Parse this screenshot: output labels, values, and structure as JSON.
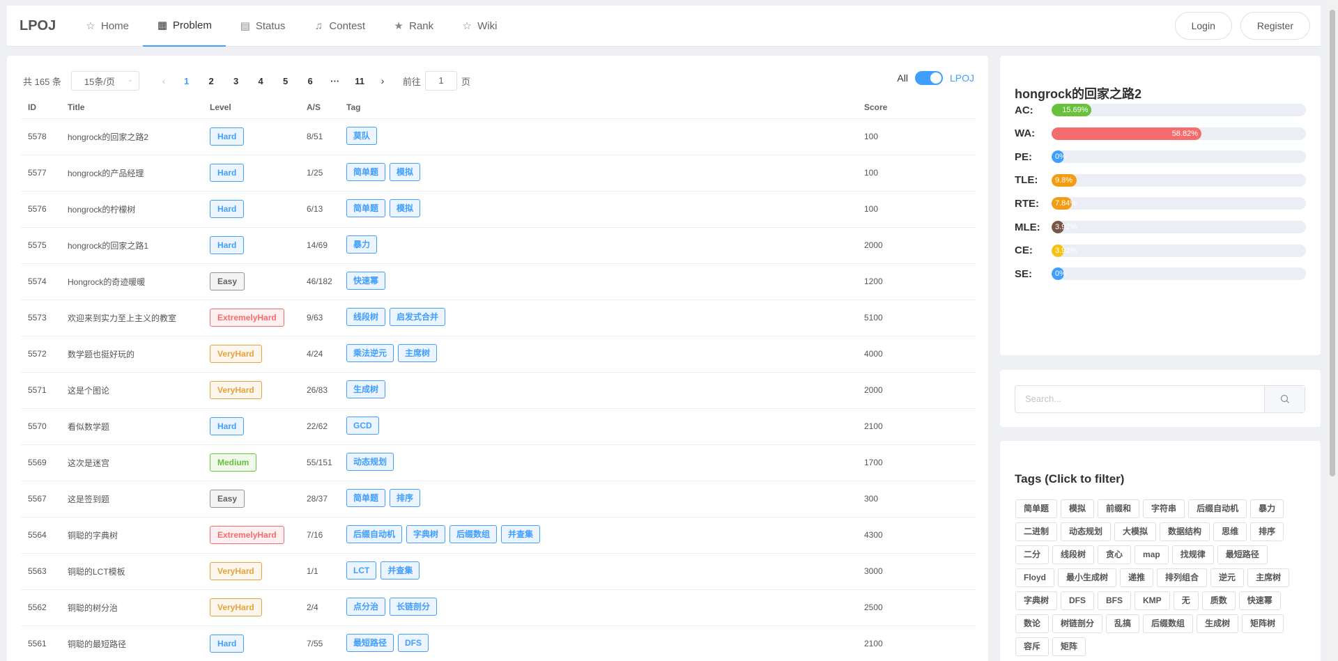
{
  "nav": {
    "logo": "LPOJ",
    "items": [
      {
        "label": "Home",
        "icon": "☆"
      },
      {
        "label": "Problem",
        "icon": "▦"
      },
      {
        "label": "Status",
        "icon": "▤"
      },
      {
        "label": "Contest",
        "icon": "♫"
      },
      {
        "label": "Rank",
        "icon": "★"
      },
      {
        "label": "Wiki",
        "icon": "☆"
      }
    ],
    "login": "Login",
    "register": "Register"
  },
  "pager": {
    "total": "共 165 条",
    "page_size": "15条/页",
    "pages": [
      "1",
      "2",
      "3",
      "4",
      "5",
      "6",
      "···",
      "11"
    ],
    "goto_prefix": "前往",
    "goto_value": "1",
    "goto_suffix": "页"
  },
  "toggle": {
    "left": "All",
    "right": "LPOJ"
  },
  "table": {
    "headers": {
      "id": "ID",
      "title": "Title",
      "level": "Level",
      "as": "A/S",
      "tag": "Tag",
      "score": "Score"
    },
    "rows": [
      {
        "id": "5578",
        "title": "hongrock的回家之路2",
        "level": "Hard",
        "as": "8/51",
        "tags": [
          "莫队"
        ],
        "score": "100"
      },
      {
        "id": "5577",
        "title": "hongrock的产品经理",
        "level": "Hard",
        "as": "1/25",
        "tags": [
          "简单题",
          "模拟"
        ],
        "score": "100"
      },
      {
        "id": "5576",
        "title": "hongrock的柠檬树",
        "level": "Hard",
        "as": "6/13",
        "tags": [
          "简单题",
          "模拟"
        ],
        "score": "100"
      },
      {
        "id": "5575",
        "title": "hongrock的回家之路1",
        "level": "Hard",
        "as": "14/69",
        "tags": [
          "暴力"
        ],
        "score": "2000"
      },
      {
        "id": "5574",
        "title": "Hongrock的奇迹暖暖",
        "level": "Easy",
        "as": "46/182",
        "tags": [
          "快速幂"
        ],
        "score": "1200"
      },
      {
        "id": "5573",
        "title": "欢迎来到实力至上主义的教室",
        "level": "ExtremelyHard",
        "as": "9/63",
        "tags": [
          "线段树",
          "启发式合并"
        ],
        "score": "5100"
      },
      {
        "id": "5572",
        "title": "数学题也挺好玩的",
        "level": "VeryHard",
        "as": "4/24",
        "tags": [
          "乘法逆元",
          "主席树"
        ],
        "score": "4000"
      },
      {
        "id": "5571",
        "title": "这是个图论",
        "level": "VeryHard",
        "as": "26/83",
        "tags": [
          "生成树"
        ],
        "score": "2000"
      },
      {
        "id": "5570",
        "title": "看似数学题",
        "level": "Hard",
        "as": "22/62",
        "tags": [
          "GCD"
        ],
        "score": "2100"
      },
      {
        "id": "5569",
        "title": "这次是迷宫",
        "level": "Medium",
        "as": "55/151",
        "tags": [
          "动态规划"
        ],
        "score": "1700"
      },
      {
        "id": "5567",
        "title": "这是签到题",
        "level": "Easy",
        "as": "28/37",
        "tags": [
          "简单题",
          "排序"
        ],
        "score": "300"
      },
      {
        "id": "5564",
        "title": "铜聪的字典树",
        "level": "ExtremelyHard",
        "as": "7/16",
        "tags": [
          "后缀自动机",
          "字典树",
          "后缀数组",
          "并查集"
        ],
        "score": "4300"
      },
      {
        "id": "5563",
        "title": "铜聪的LCT模板",
        "level": "VeryHard",
        "as": "1/1",
        "tags": [
          "LCT",
          "并查集"
        ],
        "score": "3000"
      },
      {
        "id": "5562",
        "title": "铜聪的树分治",
        "level": "VeryHard",
        "as": "2/4",
        "tags": [
          "点分治",
          "长链剖分"
        ],
        "score": "2500"
      },
      {
        "id": "5561",
        "title": "铜聪的最短路径",
        "level": "Hard",
        "as": "7/55",
        "tags": [
          "最短路径",
          "DFS"
        ],
        "score": "2100"
      }
    ]
  },
  "stats": {
    "title": "hongrock的回家之路2",
    "rows": [
      {
        "label": "AC:",
        "text": "15.69%",
        "pct": 15.69,
        "color": "#67c23a"
      },
      {
        "label": "WA:",
        "text": "58.82%",
        "pct": 58.82,
        "color": "#f56c6c"
      },
      {
        "label": "PE:",
        "text": "0%",
        "pct": 0,
        "color": "#409eff"
      },
      {
        "label": "TLE:",
        "text": "9.8%",
        "pct": 9.8,
        "color": "#f39c12"
      },
      {
        "label": "RTE:",
        "text": "7.84%",
        "pct": 7.84,
        "color": "#f39c12"
      },
      {
        "label": "MLE:",
        "text": "3.92%",
        "pct": 3.92,
        "color": "#795548"
      },
      {
        "label": "CE:",
        "text": "3.92%",
        "pct": 3.92,
        "color": "#f5c211"
      },
      {
        "label": "SE:",
        "text": "0%",
        "pct": 0,
        "color": "#409eff"
      }
    ]
  },
  "search": {
    "placeholder": "Search..."
  },
  "tags_panel": {
    "title": "Tags (Click to filter)",
    "tags": [
      "简单题",
      "模拟",
      "前缀和",
      "字符串",
      "后缀自动机",
      "暴力",
      "二进制",
      "动态规划",
      "大模拟",
      "数据结构",
      "思维",
      "排序",
      "二分",
      "线段树",
      "贪心",
      "map",
      "找规律",
      "最短路径",
      "Floyd",
      "最小生成树",
      "递推",
      "排列组合",
      "逆元",
      "主席树",
      "字典树",
      "DFS",
      "BFS",
      "KMP",
      "无",
      "质数",
      "快速幂",
      "数论",
      "树链剖分",
      "乱搞",
      "后缀数组",
      "生成树",
      "矩阵树",
      "容斥",
      "矩阵"
    ]
  }
}
